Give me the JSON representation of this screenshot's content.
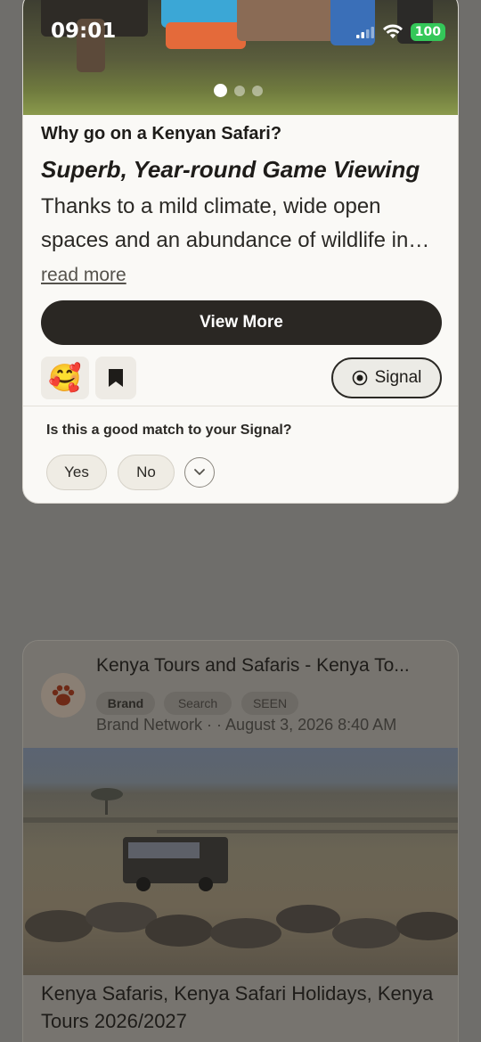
{
  "status": {
    "time": "09:01",
    "battery": "100"
  },
  "top_card": {
    "question": "Why go on a Kenyan Safari?",
    "headline": "Superb, Year-round Game Viewing",
    "description": "Thanks to a mild climate, wide open spaces and an abundance of wildlife in…",
    "read_more": "read more",
    "view_more_label": "View More",
    "reaction_emoji": "🥰",
    "signal_label": "Signal",
    "match_question": "Is this a good match to your Signal?",
    "yes_label": "Yes",
    "no_label": "No",
    "carousel": {
      "count": 3,
      "active": 1
    }
  },
  "bottom_card": {
    "title": "Kenya Tours and Safaris - Kenya To...",
    "tags": [
      "Brand",
      "Search",
      "SEEN"
    ],
    "meta": "Brand Network · · August 3, 2026 8:40 AM",
    "heading": "Kenya Safaris, Kenya Safari Holidays, Kenya Tours 2026/2027"
  },
  "colors": {
    "backdrop": "#6f6e6b",
    "card_bg": "#faf9f6",
    "primary_button": "#2a2723",
    "battery": "#34c759"
  },
  "icons": [
    "signal-bars-icon",
    "wifi-icon",
    "battery-icon",
    "bookmark-icon",
    "signal-target-icon",
    "chevron-down-icon",
    "paw-logo-icon"
  ]
}
